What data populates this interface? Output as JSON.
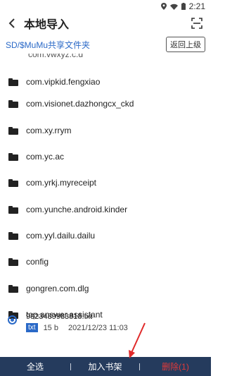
{
  "status_bar": {
    "time": "2:21"
  },
  "header": {
    "title": "本地导入"
  },
  "path_bar": {
    "path": "SD/$MuMu共享文件夹",
    "up_button": "返回上级"
  },
  "partial_item": "com.vwxyz.c.d",
  "folders": [
    "com.vipkid.fengxiao",
    "com.visionet.dazhongcx_ckd",
    "com.xy.rrym",
    "com.yc.ac",
    "com.yrkj.myreceipt",
    "com.yunche.android.kinder",
    "com.yyl.dailu.dailu",
    "config",
    "gongren.com.dlg",
    "top.answer.assistant"
  ],
  "file": {
    "name": "9923489983818.txt",
    "type": "txt",
    "size": "15 b",
    "date": "2021/12/23 11:03",
    "selected": true
  },
  "bottom_bar": {
    "select_all": "全选",
    "add_to_shelf": "加入书架",
    "delete": "删除(1)",
    "delete_color": "#e03a3a"
  },
  "colors": {
    "accent": "#2a69c7",
    "bottom_bar_bg": "#253b5d",
    "arrow": "#e02a2a"
  }
}
